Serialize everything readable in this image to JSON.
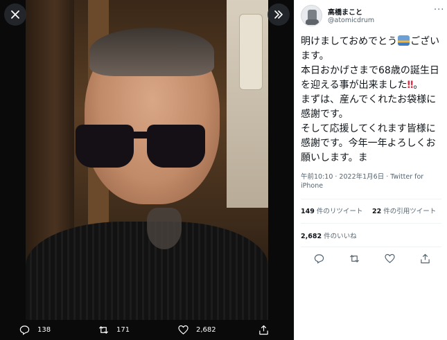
{
  "viewer": {
    "close_icon": "close-icon",
    "expand_icon": "chevron-double-right-icon",
    "actions": {
      "replies": "138",
      "retweets": "171",
      "likes": "2,682"
    }
  },
  "tweet": {
    "author_name": "高橋まこと",
    "handle": "@atomicdrum",
    "text_part1": "明けましておめでとう",
    "text_part2": "ございます。\n本日おかげさまで68歳の誕生日を迎える事が出来ました",
    "text_part3": "‼",
    "text_part4": "。\nまずは、産んでくれたお袋様に感謝です。\nそして応援してくれます皆様に感謝です。今年一年よろしくお願いします。ま",
    "meta": "午前10:10 · 2022年1月6日 · Twitter for iPhone",
    "retweet_count": "149",
    "retweet_label": " 件のリツイート",
    "quote_count": "22",
    "quote_label": " 件の引用ツイート",
    "like_count": "2,682",
    "like_label": " 件のいいね"
  },
  "colors": {
    "viewer_bg": "#0a0a0a",
    "panel_bg": "#ffffff",
    "secondary_text": "#536471",
    "bangs": "#dd2e44"
  }
}
